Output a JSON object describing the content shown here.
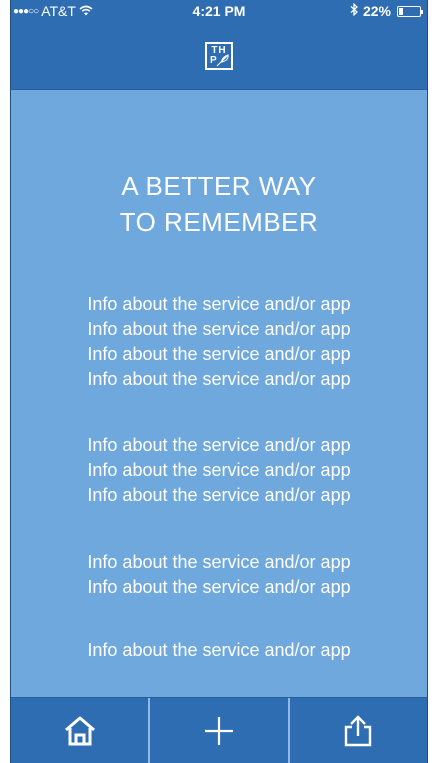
{
  "status_bar": {
    "signal": "●●●○○",
    "carrier": "AT&T",
    "time": "4:21 PM",
    "battery": "22%",
    "battery_level": 0.22
  },
  "header": {
    "logo_line1": "TH",
    "logo_line2": "P"
  },
  "main": {
    "headline_line1": "A BETTER WAY",
    "headline_line2": "TO REMEMBER",
    "info_groups": [
      [
        "Info about the service and/or app",
        "Info about the service and/or app",
        "Info about the service and/or app",
        "Info about the service and/or app"
      ],
      [
        "Info about the service and/or app",
        "Info about the service and/or app",
        "Info about the service and/or app"
      ],
      [
        "Info about the service and/or app",
        "Info about the service and/or app"
      ],
      [
        "Info about the service and/or app"
      ]
    ]
  },
  "tab_bar": {
    "icons": [
      "home-icon",
      "plus-icon",
      "share-icon"
    ]
  },
  "colors": {
    "bar": "#2f6db3",
    "background": "#6fa8dc",
    "text": "#ffffff"
  }
}
